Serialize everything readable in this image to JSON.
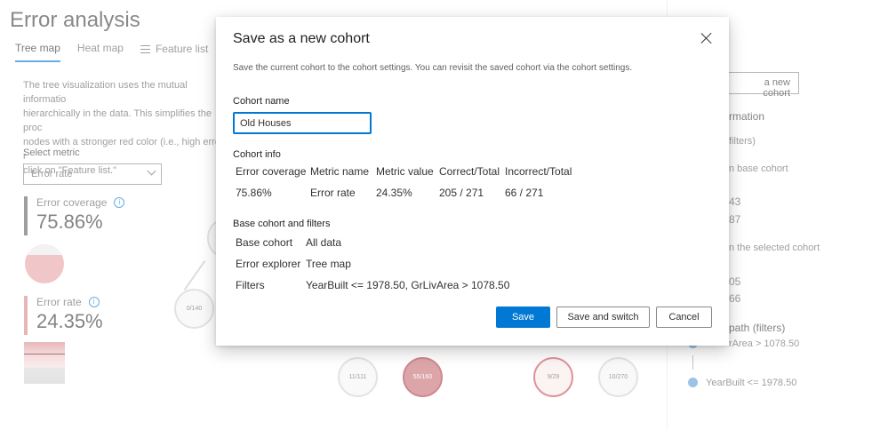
{
  "app": {
    "title": "Error analysis",
    "tabs": [
      {
        "label": "Tree map",
        "active": true
      },
      {
        "label": "Heat map",
        "active": false
      },
      {
        "label": "Feature list",
        "active": false
      }
    ],
    "description_lines": [
      "The tree visualization uses the mutual informatio",
      "hierarchically in the data. This simplifies the proc",
      "nodes with a stronger red color (i.e., high error r",
      "click on \"Feature list.\""
    ],
    "select_metric_label": "Select metric",
    "select_metric_value": "Error rate",
    "error_coverage": {
      "label": "Error coverage",
      "value": "75.86%"
    },
    "error_rate": {
      "label": "Error rate",
      "value": "24.35%"
    },
    "tree_nodes": [
      "0/140",
      "11/111",
      "55/160",
      "9/29",
      "10/270"
    ],
    "side_panel": {
      "save_button": "a new cohort",
      "lines": [
        "rmation",
        "filters)",
        "n base cohort",
        "43",
        "87",
        "n the selected cohort",
        "05",
        "66",
        "path (filters)",
        "rArea > 1078.50",
        "YearBuilt <= 1978.50"
      ]
    }
  },
  "dialog": {
    "title": "Save as a new cohort",
    "subtitle": "Save the current cohort to the cohort settings. You can revisit the saved cohort via the cohort settings.",
    "cohort_name_label": "Cohort name",
    "cohort_name_value": "Old Houses",
    "cohort_info_label": "Cohort info",
    "info_headers": [
      "Error coverage",
      "Metric name",
      "Metric value",
      "Correct/Total",
      "Incorrect/Total"
    ],
    "info_values": [
      "75.86%",
      "Error rate",
      "24.35%",
      "205 / 271",
      "66 / 271"
    ],
    "base_label": "Base cohort and filters",
    "base_rows": [
      {
        "key": "Base cohort",
        "value": "All data"
      },
      {
        "key": "Error explorer",
        "value": "Tree map"
      },
      {
        "key": "Filters",
        "value": "YearBuilt <= 1978.50, GrLivArea > 1078.50"
      }
    ],
    "buttons": {
      "save": "Save",
      "save_switch": "Save and switch",
      "cancel": "Cancel"
    }
  },
  "colors": {
    "accent": "#0078d4",
    "error_red": "#c84c55"
  }
}
